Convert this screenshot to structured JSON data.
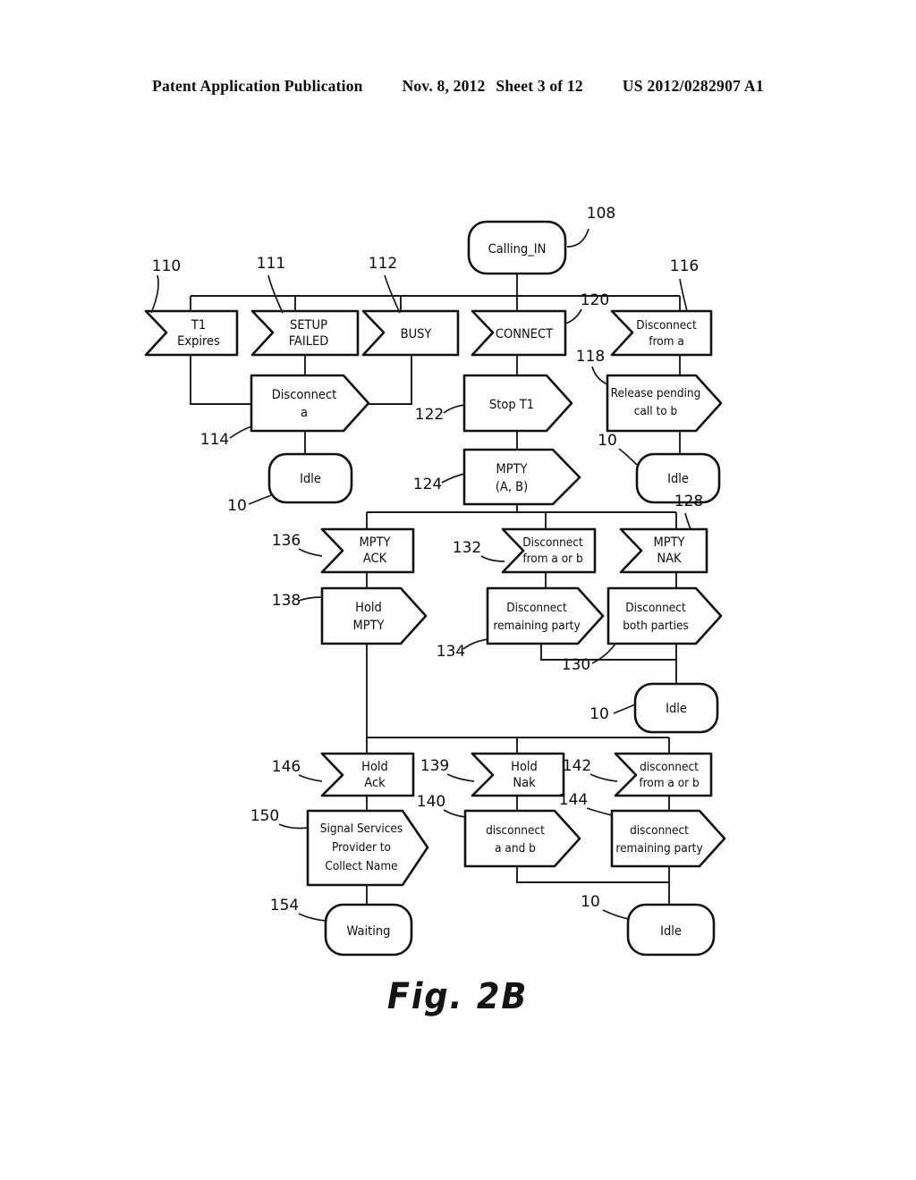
{
  "header": {
    "publication": "Patent Application Publication",
    "date": "Nov. 8, 2012",
    "sheet": "Sheet 3 of 12",
    "number": "US 2012/0282907 A1"
  },
  "figure": {
    "caption": "Fig. 2B"
  },
  "chart_data": {
    "type": "diagram",
    "title": "Fig. 2B",
    "diagram_kind": "state-transition flowchart",
    "nodes": [
      {
        "id": "n108",
        "ref": "108",
        "label": "Calling_IN",
        "shape": "rounded-state"
      },
      {
        "id": "n110",
        "ref": "110",
        "label": "T1\nExpires",
        "shape": "flag-event"
      },
      {
        "id": "n111",
        "ref": "111",
        "label": "SETUP\nFAILED",
        "shape": "flag-event"
      },
      {
        "id": "n112",
        "ref": "112",
        "label": "BUSY",
        "shape": "flag-event"
      },
      {
        "id": "n120",
        "ref": "120",
        "label": "CONNECT",
        "shape": "flag-event"
      },
      {
        "id": "n116",
        "ref": "116",
        "label": "Disconnect\nfrom a",
        "shape": "flag-event"
      },
      {
        "id": "n114",
        "ref": "114",
        "label": "Disconnect\na",
        "shape": "arrow-action"
      },
      {
        "id": "n122",
        "ref": "122",
        "label": "Stop T1",
        "shape": "arrow-action"
      },
      {
        "id": "n118",
        "ref": "118",
        "label": "Release pending\ncall to b",
        "shape": "arrow-action"
      },
      {
        "id": "n10a",
        "ref": "10",
        "label": "Idle",
        "shape": "rounded-state"
      },
      {
        "id": "n10b",
        "ref": "10",
        "label": "Idle",
        "shape": "rounded-state"
      },
      {
        "id": "n124",
        "ref": "124",
        "label": "MPTY\n(A, B)",
        "shape": "arrow-action"
      },
      {
        "id": "n136",
        "ref": "136",
        "label": "MPTY\nACK",
        "shape": "flag-event"
      },
      {
        "id": "n132",
        "ref": "132",
        "label": "Disconnect\nfrom a or b",
        "shape": "flag-event"
      },
      {
        "id": "n128",
        "ref": "128",
        "label": "MPTY\nNAK",
        "shape": "flag-event"
      },
      {
        "id": "n138",
        "ref": "138",
        "label": "Hold\nMPTY",
        "shape": "arrow-action"
      },
      {
        "id": "n134",
        "ref": "134",
        "label": "Disconnect\nremaining party",
        "shape": "arrow-action"
      },
      {
        "id": "n130",
        "ref": "130",
        "label": "Disconnect\nboth parties",
        "shape": "arrow-action"
      },
      {
        "id": "n10c",
        "ref": "10",
        "label": "Idle",
        "shape": "rounded-state"
      },
      {
        "id": "n146",
        "ref": "146",
        "label": "Hold\nAck",
        "shape": "flag-event"
      },
      {
        "id": "n139",
        "ref": "139",
        "label": "Hold\nNak",
        "shape": "flag-event"
      },
      {
        "id": "n142",
        "ref": "142",
        "label": "disconnect\nfrom a or b",
        "shape": "flag-event"
      },
      {
        "id": "n150",
        "ref": "150",
        "label": "Signal Services\nProvider to\nCollect Name",
        "shape": "arrow-action"
      },
      {
        "id": "n140",
        "ref": "140",
        "label": "disconnect\na and b",
        "shape": "arrow-action"
      },
      {
        "id": "n144",
        "ref": "144",
        "label": "disconnect\nremaining party",
        "shape": "arrow-action"
      },
      {
        "id": "n154",
        "ref": "154",
        "label": "Waiting",
        "shape": "rounded-state"
      },
      {
        "id": "n10d",
        "ref": "10",
        "label": "Idle",
        "shape": "rounded-state"
      }
    ]
  },
  "nodes": {
    "calling_in": {
      "line1": "Calling_IN"
    },
    "t1_expires": {
      "line1": "T1",
      "line2": "Expires"
    },
    "setup_failed": {
      "line1": "SETUP",
      "line2": "FAILED"
    },
    "busy": {
      "line1": "BUSY"
    },
    "connect": {
      "line1": "CONNECT"
    },
    "disconnect_from_a": {
      "line1": "Disconnect",
      "line2": "from a"
    },
    "disconnect_a": {
      "line1": "Disconnect",
      "line2": "a"
    },
    "stop_t1": {
      "line1": "Stop T1"
    },
    "release_pending": {
      "line1": "Release pending",
      "line2": "call to b"
    },
    "idle_left": {
      "line1": "Idle"
    },
    "idle_right": {
      "line1": "Idle"
    },
    "mpty_ab": {
      "line1": "MPTY",
      "line2": "(A, B)"
    },
    "mpty_ack": {
      "line1": "MPTY",
      "line2": "ACK"
    },
    "disconnect_from_a_or_b": {
      "line1": "Disconnect",
      "line2": "from a or b"
    },
    "mpty_nak": {
      "line1": "MPTY",
      "line2": "NAK"
    },
    "hold_mpty": {
      "line1": "Hold",
      "line2": "MPTY"
    },
    "disconnect_remaining_party": {
      "line1": "Disconnect",
      "line2": "remaining party"
    },
    "disconnect_both_parties": {
      "line1": "Disconnect",
      "line2": "both parties"
    },
    "idle_mid": {
      "line1": "Idle"
    },
    "hold_ack": {
      "line1": "Hold",
      "line2": "Ack"
    },
    "hold_nak": {
      "line1": "Hold",
      "line2": "Nak"
    },
    "disconnect_from_a_or_b2": {
      "line1": "disconnect",
      "line2": "from a or b"
    },
    "signal_services": {
      "line1": "Signal Services",
      "line2": "Provider to",
      "line3": "Collect Name"
    },
    "disconnect_a_and_b": {
      "line1": "disconnect",
      "line2": "a and b"
    },
    "disconnect_remaining_party2": {
      "line1": "disconnect",
      "line2": "remaining party"
    },
    "waiting": {
      "line1": "Waiting"
    },
    "idle_bottom": {
      "line1": "Idle"
    }
  },
  "refs": {
    "r108": "108",
    "r110": "110",
    "r111": "111",
    "r112": "112",
    "r116": "116",
    "r120": "120",
    "r118": "118",
    "r114": "114",
    "r122": "122",
    "r124": "124",
    "r128": "128",
    "r132": "132",
    "r136": "136",
    "r138": "138",
    "r134": "134",
    "r130": "130",
    "r139": "139",
    "r140": "140",
    "r142": "142",
    "r144": "144",
    "r146": "146",
    "r150": "150",
    "r154": "154",
    "r10_left": "10",
    "r10_right": "10",
    "r10_mid": "10",
    "r10_bottom": "10"
  }
}
